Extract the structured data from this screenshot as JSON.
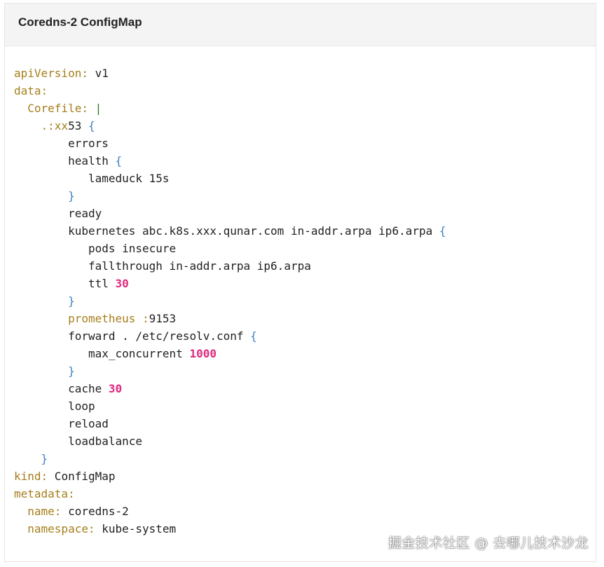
{
  "card": {
    "title": "Coredns-2 ConfigMap"
  },
  "code": {
    "l1_key": "apiVersion:",
    "l1_val": " v1",
    "l2_key": "data:",
    "l3_indent": "  ",
    "l3_key": "Corefile:",
    "l3_pipe": " |",
    "l4_indent": "    ",
    "l4_key": ".:xx",
    "l4_text": "53 ",
    "l4_brace": "{",
    "l5": "        errors",
    "l6_text": "        health ",
    "l6_brace": "{",
    "l7": "           lameduck 15s",
    "l8_indent": "        ",
    "l8_brace": "}",
    "l9": "        ready",
    "l10_text": "        kubernetes abc.k8s.xxx.qunar.com in-addr.arpa ip6.arpa ",
    "l10_brace": "{",
    "l11": "           pods insecure",
    "l12": "           fallthrough in-addr.arpa ip6.arpa",
    "l13_text": "           ttl ",
    "l13_num": "30",
    "l14_indent": "        ",
    "l14_brace": "}",
    "l15_indent": "        ",
    "l15_key": "prometheus :",
    "l15_val": "9153",
    "l16_text": "        forward . /etc/resolv.conf ",
    "l16_brace": "{",
    "l17_text": "           max_concurrent ",
    "l17_num": "1000",
    "l18_indent": "        ",
    "l18_brace": "}",
    "l19_text": "        cache ",
    "l19_num": "30",
    "l20": "        loop",
    "l21": "        reload",
    "l22": "        loadbalance",
    "l23_indent": "    ",
    "l23_brace": "}",
    "l24_key": "kind:",
    "l24_val": " ConfigMap",
    "l25_key": "metadata:",
    "l26_indent": "  ",
    "l26_key": "name:",
    "l26_val": " coredns-2",
    "l27_indent": "  ",
    "l27_key": "namespace:",
    "l27_val": " kube-system"
  },
  "watermark": "掘金技术社区 @ 去哪儿技术沙龙",
  "colors": {
    "key": "#a67f1b",
    "brace": "#3b82c4",
    "number": "#e0297f"
  }
}
